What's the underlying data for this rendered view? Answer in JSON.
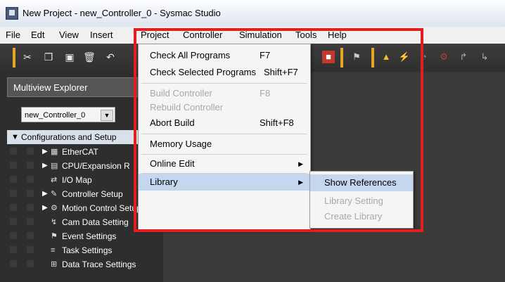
{
  "window": {
    "title": "New Project - new_Controller_0 - Sysmac Studio"
  },
  "menubar": {
    "items": [
      "File",
      "Edt",
      "View",
      "Insert",
      "Project",
      "Controller",
      "Simulation",
      "Tools",
      "Help"
    ]
  },
  "explorer": {
    "title": "Multiview Explorer",
    "controller_select": "new_Controller_0",
    "tree_root": "Configurations and Setup",
    "items": [
      "EtherCAT",
      "CPU/Expansion R",
      "I/O Map",
      "Controller Setup",
      "Motion Control Setup",
      "Cam Data Setting",
      "Event Settings",
      "Task Settings",
      "Data Trace Settings"
    ]
  },
  "project_menu": {
    "check_all": {
      "label": "Check All Programs",
      "key": "F7"
    },
    "check_selected": {
      "label": "Check Selected Programs",
      "key": "Shift+F7"
    },
    "build": {
      "label": "Build Controller",
      "key": "F8"
    },
    "rebuild": {
      "label": "Rebuild Controller"
    },
    "abort": {
      "label": "Abort Build",
      "key": "Shift+F8"
    },
    "memory": {
      "label": "Memory Usage"
    },
    "online_edit": {
      "label": "Online Edit"
    },
    "library": {
      "label": "Library"
    }
  },
  "library_submenu": {
    "show_refs": "Show References",
    "setting": "Library Setting",
    "create": "Create Library"
  },
  "colors": {
    "highlight": "#e41e1e",
    "toolbar_separator": "#e6a623",
    "selected_item": "#c5d7ee"
  }
}
